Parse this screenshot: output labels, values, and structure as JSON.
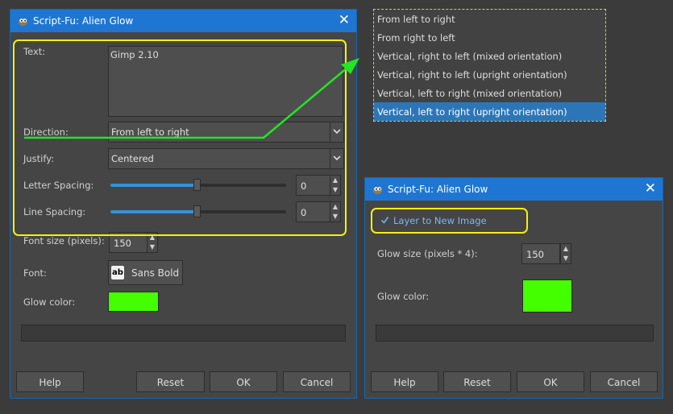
{
  "main_dialog": {
    "title": "Script-Fu: Alien Glow",
    "text_label": "Text:",
    "text_value": "Gimp 2.10",
    "direction_label": "Direction:",
    "direction_value": "From left to right",
    "justify_label": "Justify:",
    "justify_value": "Centered",
    "letter_spacing_label": "Letter Spacing:",
    "letter_spacing_value": "0",
    "line_spacing_label": "Line Spacing:",
    "line_spacing_value": "0",
    "font_size_label": "Font size (pixels):",
    "font_size_value": "150",
    "font_label": "Font:",
    "font_icon_text": "ab",
    "font_value": "Sans Bold",
    "glow_color_label": "Glow color:",
    "glow_color": "#44ff00",
    "buttons": {
      "help": "Help",
      "reset": "Reset",
      "ok": "OK",
      "cancel": "Cancel"
    }
  },
  "direction_menu": {
    "items": [
      "From left to right",
      "From right to left",
      "Vertical, right to left (mixed orientation)",
      "Vertical, right to left (upright orientation)",
      "Vertical, left to right (mixed orientation)",
      "Vertical, left to right (upright orientation)"
    ],
    "selected_index": 5
  },
  "second_dialog": {
    "title": "Script-Fu: Alien Glow",
    "layer_checkbox_label": "Layer to New Image",
    "layer_checkbox_checked": true,
    "glow_size_label": "Glow size (pixels * 4):",
    "glow_size_value": "150",
    "glow_color_label": "Glow color:",
    "glow_color": "#44ff00",
    "buttons": {
      "help": "Help",
      "reset": "Reset",
      "ok": "OK",
      "cancel": "Cancel"
    }
  },
  "colors": {
    "titlebar": "#1e76d2",
    "highlight": "#f5f00f",
    "annotation_arrow": "#22e622",
    "selection": "#2c76b8"
  }
}
